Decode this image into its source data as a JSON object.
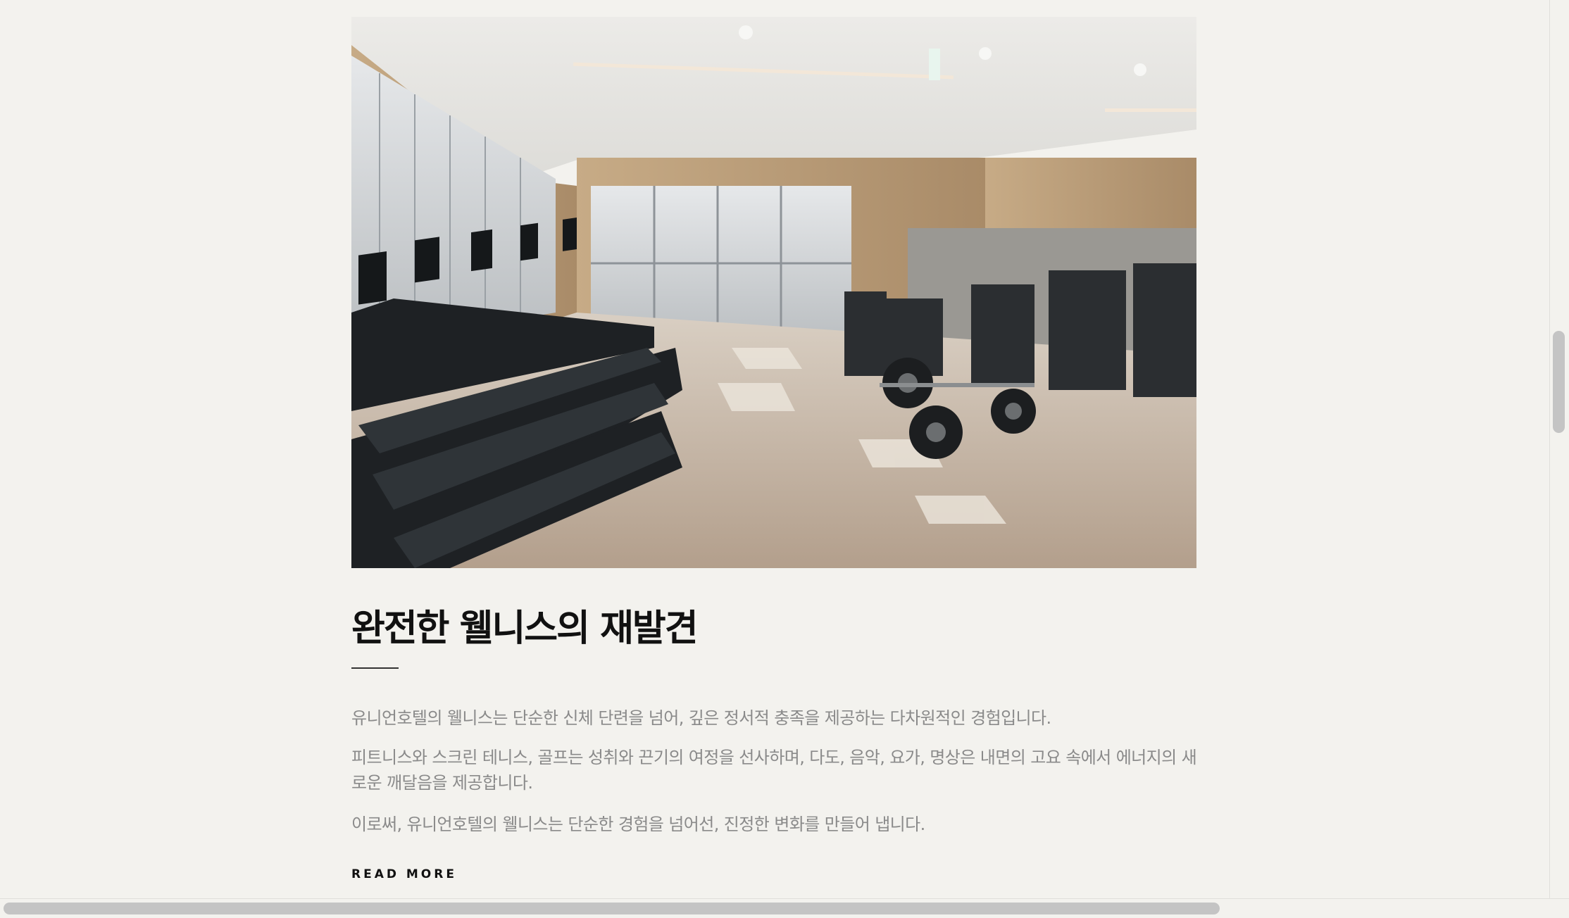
{
  "article": {
    "image_alt": "Fitness center with treadmills and weight machines",
    "title": "완전한 웰니스의 재발견",
    "paragraphs": [
      "유니언호텔의 웰니스는 단순한 신체 단련을 넘어, 깊은 정서적 충족을 제공하는 다차원적인 경험입니다.",
      "피트니스와 스크린 테니스, 골프는 성취와 끈기의 여정을 선사하며, 다도, 음악, 요가, 명상은 내면의 고요 속에서 에너지의 새로운 깨달음을 제공합니다.",
      "이로써, 유니언호텔의 웰니스는 단순한 경험을 넘어선, 진정한 변화를 만들어 냅니다."
    ],
    "read_more_label": "READ MORE"
  },
  "colors": {
    "background": "#f3f2ee",
    "title": "#111111",
    "body_text": "#8a8a8a",
    "scrollbar_thumb": "#c4c4c4"
  }
}
